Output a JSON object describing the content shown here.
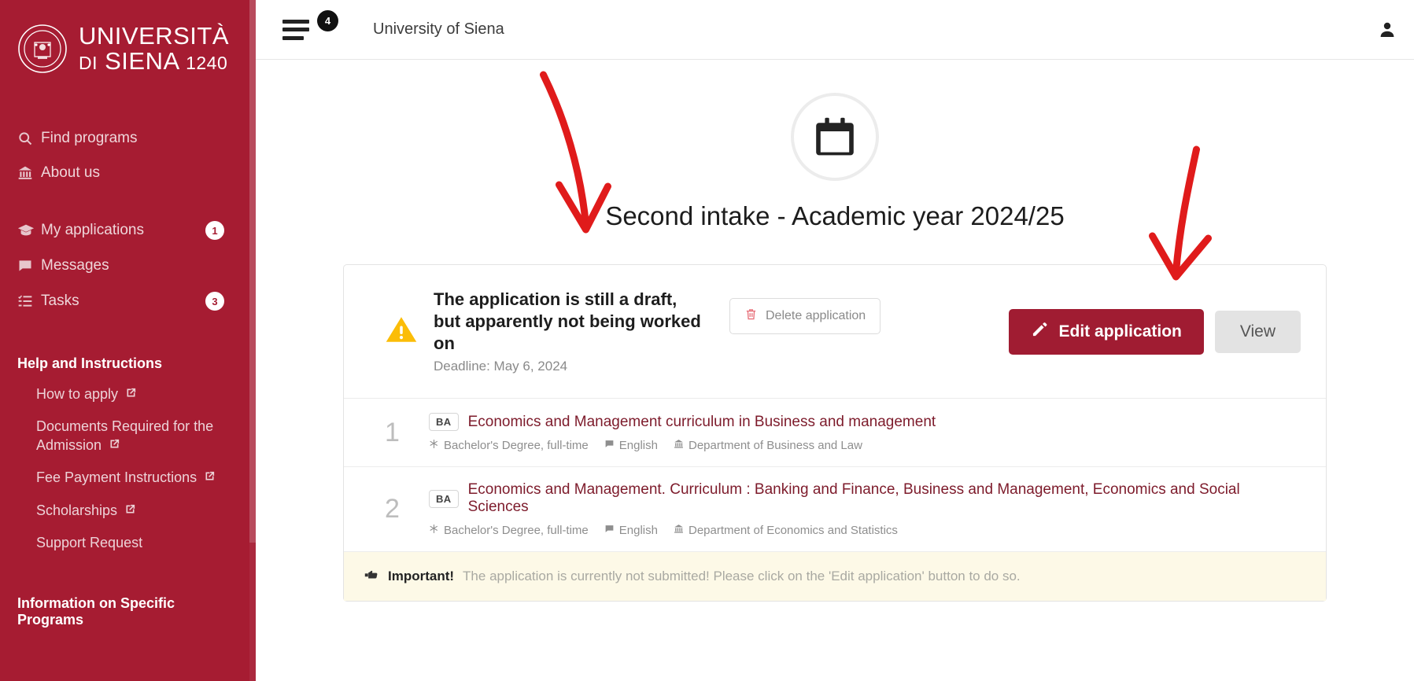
{
  "brand": {
    "logo_line1": "UNIVERSITÀ",
    "logo_di": "DI",
    "logo_siena": "SIENA",
    "logo_year": "1240",
    "accent_red": "#a61c32",
    "button_red": "#a01c32"
  },
  "sidebar": {
    "nav": [
      {
        "label": "Find programs",
        "icon": "search-icon",
        "badge": ""
      },
      {
        "label": "About us",
        "icon": "bank-icon",
        "badge": ""
      },
      {
        "label": "My applications",
        "icon": "graduation-cap-icon",
        "badge": "1"
      },
      {
        "label": "Messages",
        "icon": "chat-bubble-icon",
        "badge": ""
      },
      {
        "label": "Tasks",
        "icon": "task-list-icon",
        "badge": "3"
      }
    ],
    "help_section_title": "Help and Instructions",
    "help_links": [
      {
        "label": "How to apply",
        "external": true
      },
      {
        "label": "Documents Required for the Admission",
        "external": true
      },
      {
        "label": "Fee Payment Instructions",
        "external": true
      },
      {
        "label": "Scholarships",
        "external": true
      },
      {
        "label": "Support Request",
        "external": false
      }
    ],
    "programs_section_title": "Information on Specific Programs"
  },
  "topbar": {
    "menu_icon": "hamburger-menu-icon",
    "menu_badge": "4",
    "title": "University of Siena",
    "user_icon": "user-account-icon"
  },
  "main": {
    "header_icon": "calendar-icon",
    "page_title": "Second intake - Academic year 2024/25",
    "status": {
      "icon": "warning-triangle-icon",
      "title": "The application is still a draft, but apparently not being worked on",
      "deadline": "Deadline: May 6, 2024",
      "delete_label": "Delete application",
      "delete_icon": "trash-icon",
      "edit_label": "Edit application",
      "edit_icon": "pencil-icon",
      "view_label": "View"
    },
    "programs": [
      {
        "number": "1",
        "tag": "BA",
        "title": "Economics and Management curriculum in Business and management",
        "degree": "Bachelor's Degree, full-time",
        "language": "English",
        "department": "Department of Business and Law",
        "degree_icon": "asterisk-icon",
        "language_icon": "chat-bubble-icon",
        "department_icon": "bank-icon"
      },
      {
        "number": "2",
        "tag": "BA",
        "title": "Economics and Management. Curriculum : Banking and Finance, Business and Management, Economics and Social Sciences",
        "degree": "Bachelor's Degree, full-time",
        "language": "English",
        "department": "Department of Economics and Statistics",
        "degree_icon": "asterisk-icon",
        "language_icon": "chat-bubble-icon",
        "department_icon": "bank-icon"
      }
    ],
    "notice": {
      "icon": "pointing-hand-icon",
      "bold": "Important!",
      "text": "The application is currently not submitted! Please click on the 'Edit application' button to do so."
    }
  },
  "annotations": {
    "arrow_color": "#e01b1b",
    "arrow_left_target": "status-card-left",
    "arrow_right_target": "edit-application-button"
  }
}
